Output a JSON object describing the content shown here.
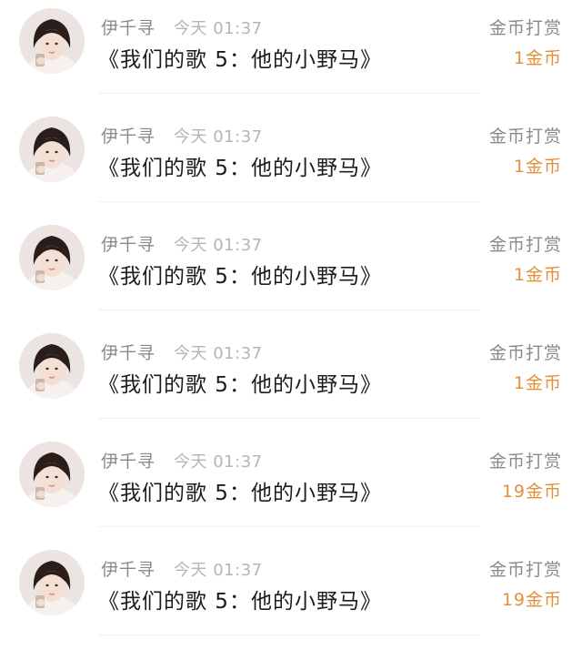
{
  "reward_list": [
    {
      "user_name": "伊千寻",
      "time": "今天 01:37",
      "song_title": "《我们的歌 5：他的小野马》",
      "reward_label": "金币打赏",
      "reward_amount": "1金币"
    },
    {
      "user_name": "伊千寻",
      "time": "今天 01:37",
      "song_title": "《我们的歌 5：他的小野马》",
      "reward_label": "金币打赏",
      "reward_amount": "1金币"
    },
    {
      "user_name": "伊千寻",
      "time": "今天 01:37",
      "song_title": "《我们的歌 5：他的小野马》",
      "reward_label": "金币打赏",
      "reward_amount": "1金币"
    },
    {
      "user_name": "伊千寻",
      "time": "今天 01:37",
      "song_title": "《我们的歌 5：他的小野马》",
      "reward_label": "金币打赏",
      "reward_amount": "1金币"
    },
    {
      "user_name": "伊千寻",
      "time": "今天 01:37",
      "song_title": "《我们的歌 5：他的小野马》",
      "reward_label": "金币打赏",
      "reward_amount": "19金币"
    },
    {
      "user_name": "伊千寻",
      "time": "今天 01:37",
      "song_title": "《我们的歌 5：他的小野马》",
      "reward_label": "金币打赏",
      "reward_amount": "19金币"
    }
  ],
  "colors": {
    "amount_accent": "#e2913a",
    "secondary_text": "#8a8a8a",
    "muted_text": "#b5b5b5",
    "primary_text": "#1c1c1c",
    "divider": "#f0f0f0"
  }
}
